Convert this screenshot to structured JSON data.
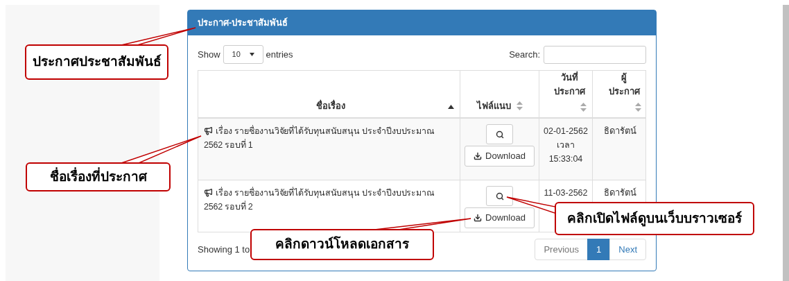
{
  "panel": {
    "title": "ประกาศ-ประชาสัมพันธ์"
  },
  "length": {
    "label_before": "Show",
    "value": "10",
    "label_after": "entries"
  },
  "search": {
    "label": "Search:"
  },
  "table": {
    "columns": [
      {
        "label": "ชื่อเรื่อง",
        "sorted": true
      },
      {
        "label": "ไฟล์แนบ",
        "sorted": false
      },
      {
        "label": "วันที่ประกาศ",
        "sorted": false
      },
      {
        "label": "ผู้ประกาศ",
        "sorted": false
      }
    ],
    "rows": [
      {
        "title": "เรื่อง รายชื่องานวิจัยที่ได้รับทุนสนับสนุน ประจำปีงบประมาณ 2562 รอบที่ 1",
        "download": "Download",
        "date": "02-01-2562 เวลา 15:33:04",
        "author": "ธิดารัตน์"
      },
      {
        "title": "เรื่อง รายชื่องานวิจัยที่ได้รับทุนสนับสนุน ประจำปีงบประมาณ 2562 รอบที่ 2",
        "download": "Download",
        "date": "11-03-2562",
        "author": "ธิดารัตน์"
      }
    ]
  },
  "info": "Showing 1 to",
  "pagination": [
    {
      "label": "Previous",
      "disabled": true,
      "selected": false
    },
    {
      "label": "1",
      "disabled": false,
      "selected": true
    },
    {
      "label": "Next",
      "disabled": false,
      "selected": false
    }
  ],
  "callouts": [
    {
      "text": "ประกาศประชาสัมพันธ์"
    },
    {
      "text": "ชื่อเรื่องที่ประกาศ"
    },
    {
      "text": "คลิกเปิดไฟล์ดูบนเว็บบราวเซอร์"
    },
    {
      "text": "คลิกดาวน์โหลดเอกสาร"
    }
  ]
}
